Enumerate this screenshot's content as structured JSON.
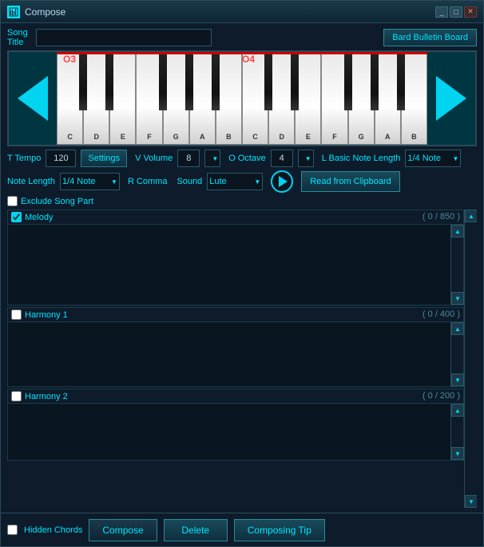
{
  "window": {
    "title": "Compose",
    "min_btn": "_",
    "max_btn": "□",
    "close_btn": "✕"
  },
  "song_title": {
    "label": "Song Title",
    "value": "",
    "placeholder": ""
  },
  "bard_btn": "Bard Bulletin Board",
  "octave_labels": {
    "o3": "O3",
    "o4": "O4"
  },
  "piano": {
    "white_keys": [
      "C",
      "D",
      "E",
      "F",
      "G",
      "A",
      "B",
      "C",
      "D",
      "E",
      "F",
      "G",
      "A",
      "B"
    ]
  },
  "controls": {
    "tempo_label": "T Tempo",
    "tempo_value": "120",
    "settings_btn": "Settings",
    "volume_label": "V Volume",
    "volume_value": "8",
    "octave_label": "O Octave",
    "octave_value": "4",
    "basic_note_label": "L Basic Note Length",
    "basic_note_value": "1/4 Note",
    "note_length_label": "Note Length",
    "note_length_value": "1/4 Note",
    "r_comma_label": "R Comma",
    "sound_label": "Sound",
    "sound_value": "Lute",
    "clipboard_btn": "Read from Clipboard"
  },
  "exclude_song_part": {
    "label": "Exclude Song Part",
    "checked": false
  },
  "tracks": {
    "melody": {
      "label": "Melody",
      "checked": true,
      "counter": "( 0 / 850 )"
    },
    "harmony1": {
      "label": "Harmony 1",
      "checked": false,
      "counter": "( 0 / 400 )"
    },
    "harmony2": {
      "label": "Harmony 2",
      "checked": false,
      "counter": "( 0 / 200 )"
    }
  },
  "bottom": {
    "hidden_chords_label": "Hidden Chords",
    "hidden_chords_checked": false,
    "compose_btn": "Compose",
    "delete_btn": "Delete",
    "tip_btn": "Composing Tip"
  },
  "colors": {
    "accent": "#00e5ff",
    "bg": "#0d1b2a",
    "border": "#2a4a5a"
  }
}
